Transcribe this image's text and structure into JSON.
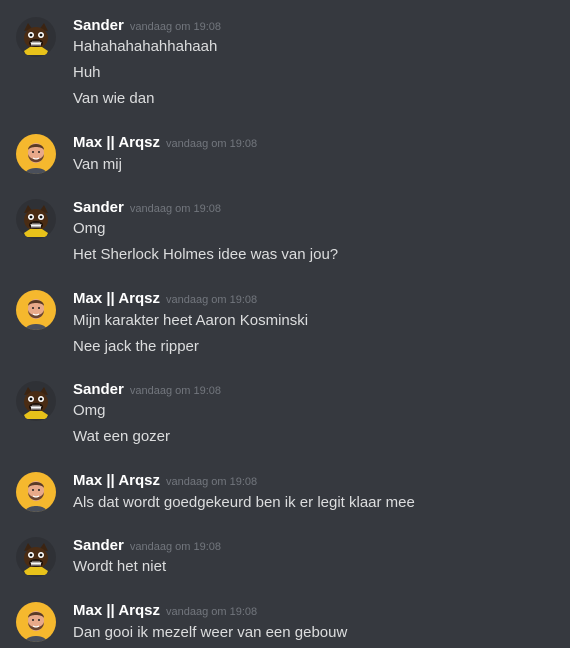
{
  "users": {
    "sander": {
      "name": "Sander",
      "avatar_icon": "dog-avatar-icon"
    },
    "max": {
      "name": "Max || Arqsz",
      "avatar_icon": "bearded-man-avatar-icon"
    }
  },
  "colors": {
    "background": "#36393f",
    "username": "#ffffff",
    "message_text": "#dcddde",
    "timestamp": "#72767d",
    "max_avatar_bg": "#f5b82e"
  },
  "groups": [
    {
      "author": "Sander",
      "timestamp": "vandaag om 19:08",
      "messages": [
        "Hahahahahahhahaah",
        "Huh",
        "Van wie dan"
      ]
    },
    {
      "author": "Max || Arqsz",
      "timestamp": "vandaag om 19:08",
      "messages": [
        "Van mij"
      ]
    },
    {
      "author": "Sander",
      "timestamp": "vandaag om 19:08",
      "messages": [
        "Omg",
        "Het Sherlock Holmes idee was van jou?"
      ]
    },
    {
      "author": "Max || Arqsz",
      "timestamp": "vandaag om 19:08",
      "messages": [
        "Mijn karakter heet Aaron Kosminski",
        "Nee jack the ripper"
      ]
    },
    {
      "author": "Sander",
      "timestamp": "vandaag om 19:08",
      "messages": [
        "Omg",
        "Wat een gozer"
      ]
    },
    {
      "author": "Max || Arqsz",
      "timestamp": "vandaag om 19:08",
      "messages": [
        "Als dat wordt goedgekeurd ben ik er legit klaar mee"
      ]
    },
    {
      "author": "Sander",
      "timestamp": "vandaag om 19:08",
      "messages": [
        "Wordt het niet"
      ]
    },
    {
      "author": "Max || Arqsz",
      "timestamp": "vandaag om 19:08",
      "messages": [
        "Dan gooi ik mezelf weer van een gebouw"
      ]
    }
  ]
}
